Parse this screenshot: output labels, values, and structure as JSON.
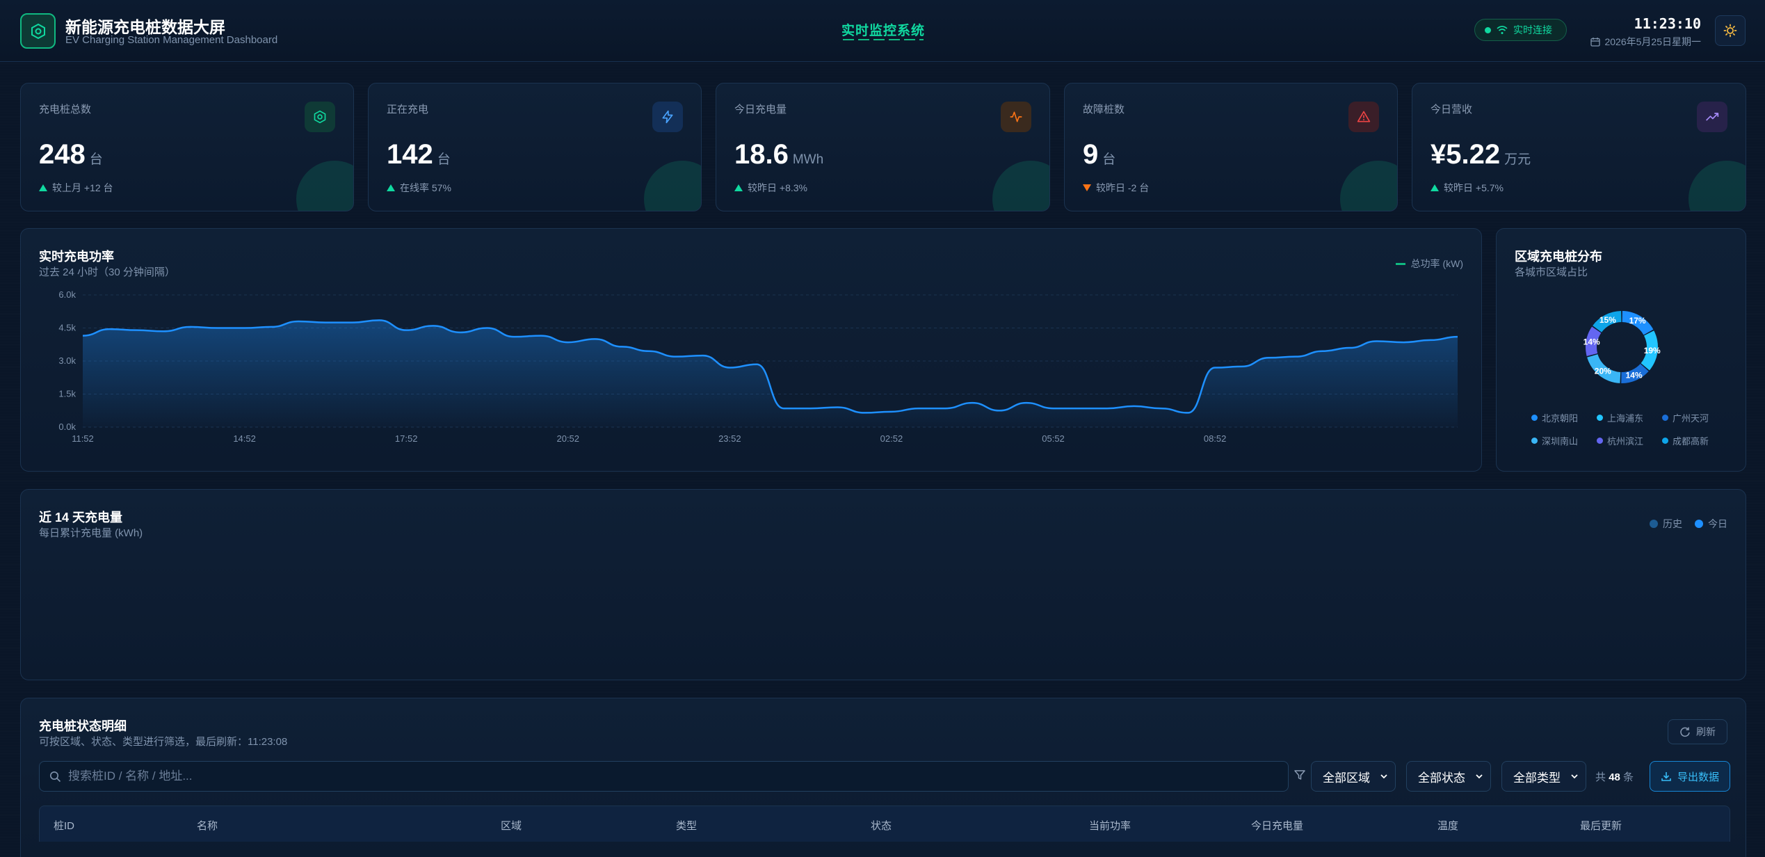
{
  "header": {
    "title": "新能源充电桩数据大屏",
    "subtitle": "EV Charging Station Management Dashboard",
    "center_title": "实时监控系统",
    "connection": "实时连接",
    "time": "11:23:10",
    "date": "2026年5月25日星期一"
  },
  "stats": [
    {
      "label": "充电桩总数",
      "value": "248",
      "unit": "台",
      "delta": "较上月 +12 台",
      "trend": "up",
      "icon": "cpu-icon",
      "color": "#10b981"
    },
    {
      "label": "正在充电",
      "value": "142",
      "unit": "台",
      "delta": "在线率 57%",
      "trend": "up",
      "icon": "lightning-icon",
      "color": "#3b82f6"
    },
    {
      "label": "今日充电量",
      "value": "18.6",
      "unit": "MWh",
      "delta": "较昨日 +8.3%",
      "trend": "up",
      "icon": "activity-icon",
      "color": "#f97316"
    },
    {
      "label": "故障桩数",
      "value": "9",
      "unit": "台",
      "delta": "较昨日 -2 台",
      "trend": "down",
      "icon": "alert-triangle-icon",
      "color": "#ef4444"
    },
    {
      "label": "今日营收",
      "value": "¥5.22",
      "unit": "万元",
      "delta": "较昨日 +5.7%",
      "trend": "up",
      "icon": "trending-up-icon",
      "color": "#8b5cf6"
    }
  ],
  "power_panel": {
    "title": "实时充电功率",
    "subtitle": "过去 24 小时（30 分钟间隔）",
    "legend": "总功率 (kW)"
  },
  "region_panel": {
    "title": "区域充电桩分布",
    "subtitle": "各城市区域占比"
  },
  "history_panel": {
    "title": "近 14 天充电量",
    "subtitle": "每日累计充电量 (kWh)",
    "legend_history": "历史",
    "legend_today": "今日"
  },
  "table_panel": {
    "title": "充电桩状态明细",
    "subtitle": "可按区域、状态、类型进行筛选，最后刷新：11:23:08",
    "refresh": "刷新",
    "search_placeholder": "搜索桩ID / 名称 / 地址...",
    "filter_region": "全部区域",
    "filter_status": "全部状态",
    "filter_type": "全部类型",
    "count_prefix": "共",
    "count": "48",
    "count_suffix": "条",
    "export": "导出数据",
    "columns": [
      "桩ID",
      "名称",
      "区域",
      "类型",
      "状态",
      "当前功率",
      "今日充电量",
      "温度",
      "最后更新"
    ]
  },
  "chart_data": [
    {
      "type": "area",
      "title": "实时充电功率",
      "ylabel": "",
      "ylim": [
        0,
        6000
      ],
      "y_ticks": [
        "6.0k",
        "4.5k",
        "3.0k",
        "1.5k",
        "0.0k"
      ],
      "x_ticks": [
        "11:52",
        "14:52",
        "17:52",
        "20:52",
        "23:52",
        "02:52",
        "05:52",
        "08:52"
      ],
      "series": [
        {
          "name": "总功率 (kW)",
          "color": "#1e90ff",
          "values": [
            4150,
            4450,
            4400,
            4350,
            4550,
            4500,
            4500,
            4550,
            4800,
            4750,
            4750,
            4850,
            4400,
            4600,
            4300,
            4500,
            4100,
            4150,
            3850,
            4000,
            3650,
            3450,
            3200,
            3250,
            2700,
            2850,
            850,
            850,
            900,
            650,
            700,
            850,
            850,
            1100,
            750,
            1100,
            850,
            850,
            850,
            950,
            850,
            650,
            2700,
            2750,
            3150,
            3200,
            3450,
            3600,
            3900,
            3850,
            3950,
            4100
          ]
        }
      ]
    },
    {
      "type": "pie",
      "title": "区域充电桩分布",
      "categories": [
        "北京朝阳",
        "上海浦东",
        "广州天河",
        "深圳南山",
        "杭州滨江",
        "成都高新"
      ],
      "values": [
        17,
        19,
        14,
        20,
        14,
        15
      ],
      "labels": [
        "17%",
        "19%",
        "14%",
        "20%",
        "14%",
        "15%"
      ],
      "colors": [
        "#1e90ff",
        "#22c5ff",
        "#1a6ed8",
        "#3ab6f6",
        "#6366f1",
        "#0ea5e9"
      ]
    }
  ]
}
